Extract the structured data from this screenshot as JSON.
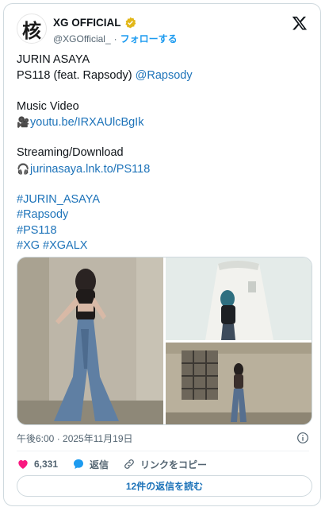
{
  "header": {
    "display_name": "XG OFFICIAL",
    "handle": "@XGOfficial_",
    "separator": "·",
    "follow_label": "フォローする",
    "avatar_glyph": "核"
  },
  "tweet": {
    "line1": "JURIN ASAYA",
    "line2_text": "PS118 (feat. Rapsody) ",
    "line2_mention": "@Rapsody",
    "mv_label": "Music Video",
    "mv_emoji": "🎥",
    "mv_link": "youtu.be/IRXAUlcBgIk",
    "stream_label": "Streaming/Download",
    "stream_emoji": "🎧",
    "stream_link": "jurinasaya.lnk.to/PS118",
    "hashtags": [
      "#JURIN_ASAYA",
      "#Rapsody",
      "#PS118"
    ],
    "hashtag_xg": "#XG",
    "hashtag_xgalx": "#XGALX"
  },
  "meta": {
    "timestamp": "午後6:00 · 2025年11月19日"
  },
  "actions": {
    "like_count": "6,331",
    "reply_label": "返信",
    "copy_link_label": "リンクをコピー"
  },
  "read_replies_label": "12件の返信を読む",
  "colors": {
    "link": "#1d73b9",
    "follow": "#1d9bf0",
    "like": "#f91880",
    "verified": "#e2b719"
  }
}
